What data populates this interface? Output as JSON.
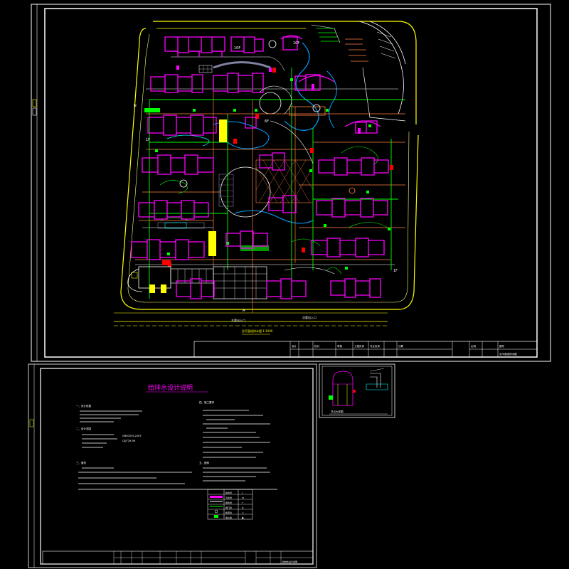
{
  "site_plan": {
    "labels": {
      "floor_10f_a": "10F",
      "floor_10f_b": "10F",
      "floor_6f": "6F",
      "floor_1f_left": "1F",
      "floor_1f_right": "1F",
      "north_mark": "N",
      "section_mark": "A",
      "road_label_1": "主要出入口",
      "road_label_2": "次要出入口",
      "plan_title": "总平面给排水图 1:1000"
    },
    "title_block": {
      "cells": [
        "设计",
        "校对",
        "审核",
        "工程负责",
        "专业负责",
        "日期",
        "比例",
        "图号"
      ],
      "drawing_name": "总平面给排水图"
    }
  },
  "notes_sheet": {
    "title": "给排水设计说明",
    "sections": [
      "一、设计依据",
      "二、设计范围",
      "三、管材",
      "四、施工要求",
      "五、图例"
    ],
    "codes": [
      "GB50015-2003",
      "CJJ/T29-98"
    ],
    "legend_rows": [
      {
        "symbol": "给水管",
        "name": "J"
      },
      {
        "symbol": "污水管",
        "name": "W"
      },
      {
        "symbol": "雨水管",
        "name": "Y"
      },
      {
        "symbol": "阀门井",
        "name": "⊗"
      },
      {
        "symbol": "检查井",
        "name": "○"
      },
      {
        "symbol": "消火栓",
        "name": "●"
      }
    ],
    "title_block_name": "给排水设计说明"
  },
  "detail_sheet": {
    "title": "节点大样图"
  },
  "colors": {
    "frame": "#ffffff",
    "building": "#ff00ff",
    "road": "#ffff00",
    "water": "#00a0ff",
    "green": "#00ff00",
    "red": "#ff0000",
    "cyan": "#00ffff",
    "orange": "#ff8040",
    "gray": "#8080a0"
  }
}
